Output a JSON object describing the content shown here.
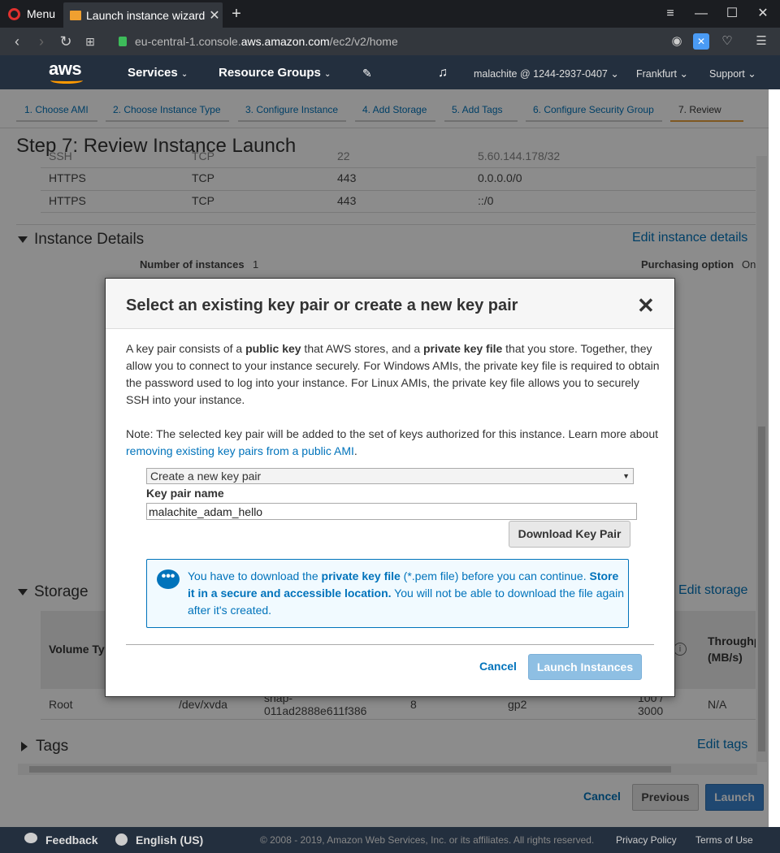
{
  "browser": {
    "menu_label": "Menu",
    "tab_title": "Launch instance wizard |",
    "url_prefix": "eu-central-1.console.",
    "url_domain": "aws.amazon.com",
    "url_path": "/ec2/v2/home"
  },
  "awsnav": {
    "logo": "aws",
    "services": "Services",
    "resource_groups": "Resource Groups",
    "account": "malachite @ 1244-2937-0407",
    "region": "Frankfurt",
    "support": "Support"
  },
  "wizard": {
    "steps": [
      "1. Choose AMI",
      "2. Choose Instance Type",
      "3. Configure Instance",
      "4. Add Storage",
      "5. Add Tags",
      "6. Configure Security Group",
      "7. Review"
    ],
    "title": "Step 7: Review Instance Launch"
  },
  "security_rules": [
    {
      "type": "SSH",
      "protocol": "TCP",
      "port": "22",
      "source": "5.60.144.178/32"
    },
    {
      "type": "HTTPS",
      "protocol": "TCP",
      "port": "443",
      "source": "0.0.0.0/0"
    },
    {
      "type": "HTTPS",
      "protocol": "TCP",
      "port": "443",
      "source": "::/0"
    }
  ],
  "instance_details": {
    "heading": "Instance Details",
    "edit_link": "Edit instance details",
    "num_label": "Number of instances",
    "num_value": "1",
    "purchasing_label": "Purchasing option",
    "purchasing_value": "On"
  },
  "storage": {
    "heading": "Storage",
    "edit_link": "Edit storage",
    "col_volume": "Volume Ty",
    "col_throughput_1": "Throughp",
    "col_throughput_2": "(MB/s)",
    "row": {
      "volume": "Root",
      "device": "/dev/xvda",
      "snapshot_1": "snap-",
      "snapshot_2": "011ad2888e611f386",
      "size": "8",
      "vtype": "gp2",
      "iops_1": "100 /",
      "iops_2": "3000",
      "throughput": "N/A"
    }
  },
  "tags": {
    "heading": "Tags",
    "edit_link": "Edit tags"
  },
  "buttons": {
    "cancel": "Cancel",
    "previous": "Previous",
    "launch": "Launch"
  },
  "footer": {
    "feedback": "Feedback",
    "language": "English (US)",
    "copyright": "© 2008 - 2019, Amazon Web Services, Inc. or its affiliates. All rights reserved.",
    "privacy": "Privacy Policy",
    "terms": "Terms of Use"
  },
  "modal": {
    "title": "Select an existing key pair or create a new key pair",
    "p1_a": "A key pair consists of a ",
    "p1_b": "public key",
    "p1_c": " that AWS stores, and a ",
    "p1_d": "private key file",
    "p1_e": " that you store. Together, they allow you to connect to your instance securely. For Windows AMIs, the private key file is required to obtain the password used to log into your instance. For Linux AMIs, the private key file allows you to securely SSH into your instance.",
    "note_a": "Note: The selected key pair will be added to the set of keys authorized for this instance. Learn more about ",
    "note_link": "removing existing key pairs from a public AMI",
    "note_b": ".",
    "select_value": "Create a new key pair",
    "key_pair_label": "Key pair name",
    "key_pair_value": "malachite_adam_hello",
    "download_button": "Download Key Pair",
    "info_a": "You have to download the ",
    "info_b": "private key file",
    "info_c": " (*.pem file) before you can continue. ",
    "info_d": "Store it in a secure and accessible location.",
    "info_e": " You will not be able to download the file again after it's created.",
    "cancel": "Cancel",
    "launch": "Launch Instances"
  }
}
